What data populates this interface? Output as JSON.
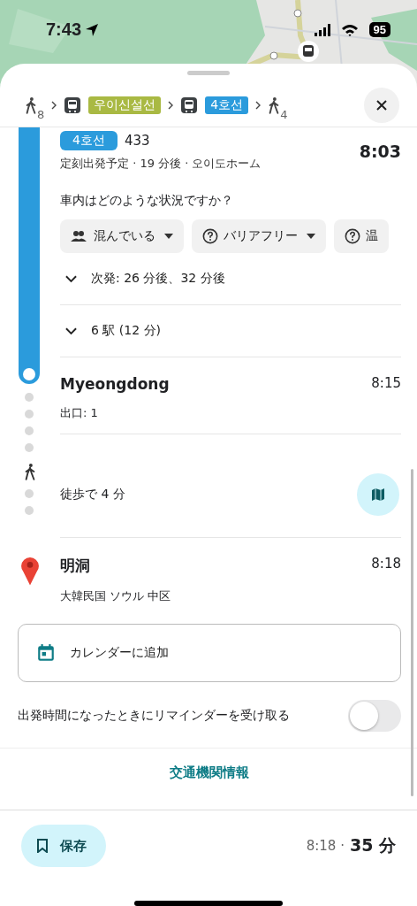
{
  "status_bar": {
    "time": "7:43",
    "battery": "95"
  },
  "steps": [
    {
      "kind": "walk",
      "minutes": "8"
    },
    {
      "kind": "transit",
      "line": "우이신설선",
      "color": "#a9b943"
    },
    {
      "kind": "transit",
      "line": "4호선",
      "color": "#2b9bdc"
    },
    {
      "kind": "walk",
      "minutes": "4"
    }
  ],
  "ride": {
    "line": "4호선",
    "train": "433",
    "departure": "定刻出発予定 · 19 分後 · 오이도ホーム",
    "time": "8:03",
    "question": "車内はどのような状況ですか？",
    "chips": [
      {
        "kind": "crowd",
        "label": "混んでいる",
        "dropdown": true
      },
      {
        "kind": "question",
        "label": "バリアフリー",
        "dropdown": true
      },
      {
        "kind": "question",
        "label": "温",
        "dropdown": false
      }
    ],
    "next": "次発: 26 分後、32 分後",
    "stops": "6 駅 (12 分)"
  },
  "arrival": {
    "name": "Myeongdong",
    "time": "8:15",
    "exit": "出口: 1"
  },
  "walk": {
    "label": "徒歩で 4 分"
  },
  "destination": {
    "name": "明洞",
    "time": "8:18",
    "address": "大韓民国 ソウル 中区"
  },
  "calendar": {
    "label": "カレンダーに追加"
  },
  "reminder": {
    "label": "出発時間になったときにリマインダーを受け取る",
    "on": false
  },
  "transit_info": "交通機関情報",
  "footer": {
    "save": "保存",
    "arrival": "8:18 ·",
    "duration": "35 分"
  }
}
